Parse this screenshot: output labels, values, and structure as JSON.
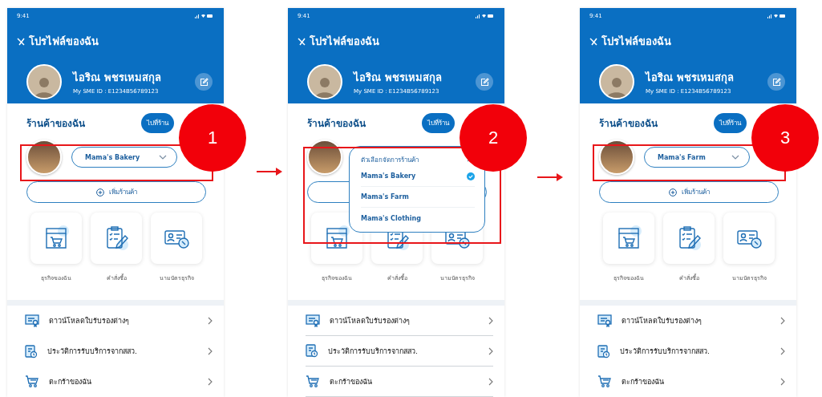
{
  "screens": [
    {
      "step": "1",
      "status_time": "9:41",
      "title": "โปรไฟล์ของฉัน",
      "profile": {
        "name": "ไอริณ พชรเหมสกุล",
        "id": "My SME ID : E1234B56789123"
      },
      "section_title": "ร้านค้าของฉัน",
      "go_button": "ไปที่ร้าน",
      "store_selector": {
        "value": "Mama's Bakery",
        "expanded": false
      },
      "add_button": "เพิ่มร้านค้า",
      "tiles": [
        "ธุรกิจของฉัน",
        "คำสั่งซื้อ",
        "นามบัตรธุรกิจ"
      ],
      "menu": [
        {
          "kind": "certificate",
          "label": "ดาวน์โหลดใบรับรองต่างๆ"
        },
        {
          "kind": "history",
          "label": "ประวัติการรับบริการจากสสว."
        },
        {
          "kind": "cart",
          "label": "ตะกร้าของฉัน"
        }
      ]
    },
    {
      "step": "2",
      "status_time": "9:41",
      "title": "โปรไฟล์ของฉัน",
      "profile": {
        "name": "ไอริณ พชรเหมสกุล",
        "id": "My SME ID : E1234B56789123"
      },
      "section_title": "ร้านค้าของฉัน",
      "go_button": "ไปที่ร้าน",
      "store_selector": {
        "expanded": true,
        "heading": "ตัวเลือกจัดการร้านค้า",
        "options": [
          {
            "label": "Mama's Bakery",
            "selected": true
          },
          {
            "label": "Mama's Farm",
            "selected": false
          },
          {
            "label": "Mama's Clothing",
            "selected": false
          }
        ]
      },
      "tiles": [
        "ธุรกิจของฉัน",
        "คำสั่งซื้อ",
        "นามบัตรธุรกิจ"
      ],
      "menu": [
        {
          "kind": "certificate",
          "label": "ดาวน์โหลดใบรับรองต่างๆ"
        },
        {
          "kind": "history",
          "label": "ประวัติการรับบริการจากสสว."
        },
        {
          "kind": "cart",
          "label": "ตะกร้าของฉัน"
        }
      ]
    },
    {
      "step": "3",
      "status_time": "9:41",
      "title": "โปรไฟล์ของฉัน",
      "profile": {
        "name": "ไอริณ พชรเหมสกุล",
        "id": "My SME ID : E1234B56789123"
      },
      "section_title": "ร้านค้าของฉัน",
      "go_button": "ไปที่ร้าน",
      "store_selector": {
        "value": "Mama's Farm",
        "expanded": false
      },
      "add_button": "เพิ่มร้านค้า",
      "tiles": [
        "ธุรกิจของฉัน",
        "คำสั่งซื้อ",
        "นามบัตรธุรกิจ"
      ],
      "menu": [
        {
          "kind": "certificate",
          "label": "ดาวน์โหลดใบรับรองต่างๆ"
        },
        {
          "kind": "history",
          "label": "ประวัติการรับบริการจากสสว."
        },
        {
          "kind": "cart",
          "label": "ตะกร้าของฉัน"
        }
      ]
    }
  ]
}
